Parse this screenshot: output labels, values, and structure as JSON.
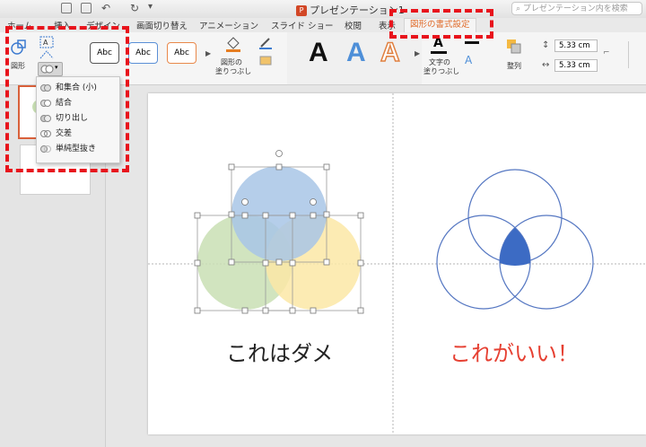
{
  "window": {
    "doc_title": "プレゼンテーション1",
    "search_placeholder": "プレゼンテーション内を検索"
  },
  "tabs": [
    {
      "label": "ホーム"
    },
    {
      "label": "挿入"
    },
    {
      "label": "デザイン"
    },
    {
      "label": "画面切り替え"
    },
    {
      "label": "アニメーション"
    },
    {
      "label": "スライド ショー"
    },
    {
      "label": "校閲"
    },
    {
      "label": "表示"
    },
    {
      "label": "図形の書式設定",
      "active": true
    }
  ],
  "ribbon": {
    "shapes_label": "図形",
    "style_samples": [
      "Abc",
      "Abc",
      "Abc"
    ],
    "fill_label_1": "図形の",
    "fill_label_2": "塗りつぶし",
    "wordart_letters": [
      "A",
      "A",
      "A"
    ],
    "text_fill_label_1": "文字の",
    "text_fill_label_2": "塗りつぶし",
    "arrange_label": "整列",
    "height_value": "5.33 cm",
    "width_value": "5.33 cm"
  },
  "merge_menu": {
    "items": [
      {
        "label": "和集合 (小)",
        "icon": "union-icon"
      },
      {
        "label": "結合",
        "icon": "combine-icon"
      },
      {
        "label": "切り出し",
        "icon": "fragment-icon"
      },
      {
        "label": "交差",
        "icon": "intersect-icon"
      },
      {
        "label": "単純型抜き",
        "icon": "subtract-icon"
      }
    ]
  },
  "slide": {
    "left_caption": "これはダメ",
    "right_caption": "これがいい！",
    "colors": {
      "blue_fill": "#a8c6e6",
      "green_fill": "#c9dfb4",
      "yellow_fill": "#fbe8a6",
      "outline_blue": "#5577c2",
      "intersection": "#3c6bc4",
      "right_caption": "#e64032",
      "left_caption": "#222222"
    }
  },
  "annotation_color": "#e8141c"
}
